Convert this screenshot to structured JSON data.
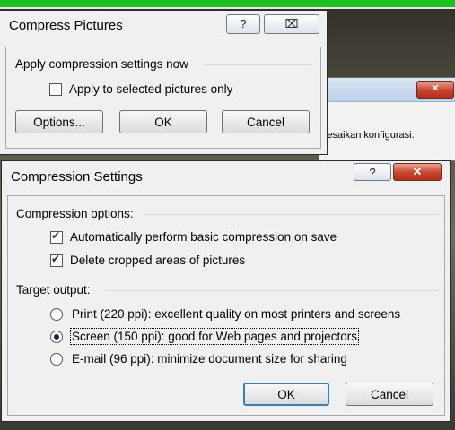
{
  "background_window": {
    "text": "lesaikan konfigurasi."
  },
  "compress_pictures": {
    "title": "Compress Pictures",
    "help_label": "?",
    "close_label": "⌧",
    "group_label": "Apply compression settings now",
    "apply_selected_label": "Apply to selected pictures only",
    "apply_selected_checked": false,
    "options_label": "Options...",
    "ok_label": "OK",
    "cancel_label": "Cancel"
  },
  "compression_settings": {
    "title": "Compression Settings",
    "help_label": "?",
    "close_label": "✕",
    "options_group_label": "Compression options:",
    "auto_compress_label": "Automatically perform basic compression on save",
    "auto_compress_checked": true,
    "delete_cropped_label": "Delete cropped areas of pictures",
    "delete_cropped_checked": true,
    "target_group_label": "Target output:",
    "targets": [
      {
        "label": "Print (220 ppi): excellent quality on most printers and screens",
        "selected": false
      },
      {
        "label": "Screen (150 ppi): good for Web pages and projectors",
        "selected": true
      },
      {
        "label": "E-mail (96 ppi): minimize document size for sharing",
        "selected": false
      }
    ],
    "ok_label": "OK",
    "cancel_label": "Cancel"
  },
  "colors": {
    "top_strip": "#20c020",
    "default_button_border": "#3c7fb1",
    "close_button_red": "#c8432a"
  }
}
